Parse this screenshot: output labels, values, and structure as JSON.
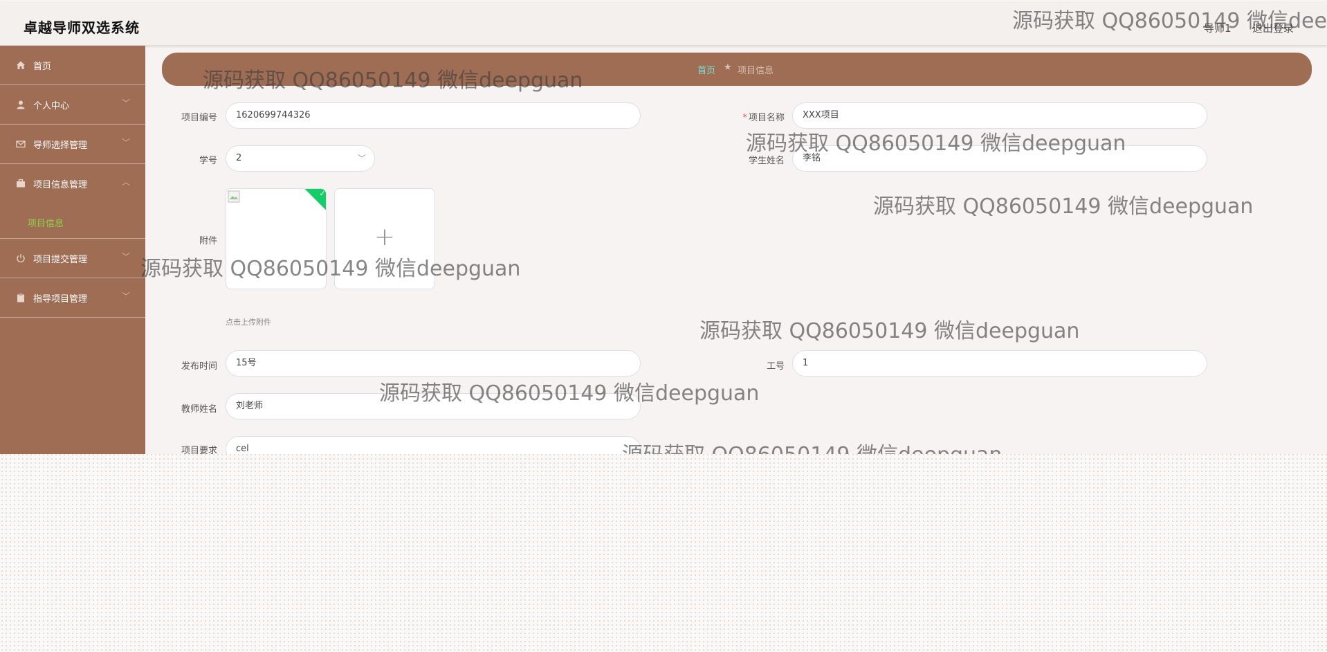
{
  "header": {
    "title": "卓越导师双选系统",
    "user": "导师1",
    "logout": "退出登录"
  },
  "sidebar": {
    "items": [
      {
        "label": "首页",
        "icon": "home-icon"
      },
      {
        "label": "个人中心",
        "icon": "user-icon"
      },
      {
        "label": "导师选择管理",
        "icon": "mail-icon"
      },
      {
        "label": "项目信息管理",
        "icon": "briefcase-icon"
      },
      {
        "label": "项目提交管理",
        "icon": "power-icon"
      },
      {
        "label": "指导项目管理",
        "icon": "clipboard-icon"
      }
    ],
    "sub_item": "项目信息"
  },
  "breadcrumb": {
    "home": "首页",
    "separator": "★",
    "current": "项目信息"
  },
  "form": {
    "project_no": {
      "label": "项目编号",
      "value": "1620699744326"
    },
    "project_name": {
      "label": "项目名称",
      "value": "XXX项目",
      "required": true
    },
    "student_no": {
      "label": "学号",
      "value": "2"
    },
    "student_name": {
      "label": "学生姓名",
      "value": "李铭"
    },
    "attachment": {
      "label": "附件",
      "tip": "点击上传附件",
      "add": "+"
    },
    "publish_time": {
      "label": "发布时间",
      "value": "15号"
    },
    "staff_no": {
      "label": "工号",
      "value": "1"
    },
    "teacher_name": {
      "label": "教师姓名",
      "value": "刘老师"
    },
    "requirement": {
      "label": "项目要求",
      "value": "cel"
    }
  },
  "watermark": "源码获取 QQ86050149 微信deepguan",
  "watermark_clipped": "源码获取 QQ86050149 微信deep",
  "colors": {
    "sidebar": "#9e6d54",
    "accent_green": "#8fd14a",
    "breadcrumb_home": "#7fe0d8"
  }
}
